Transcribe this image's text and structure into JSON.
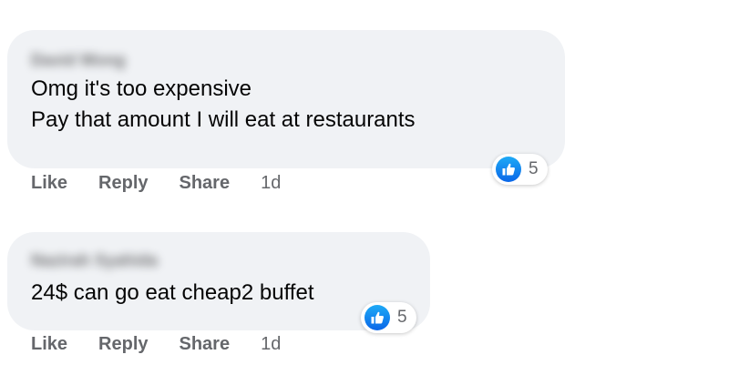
{
  "comments": [
    {
      "author": "David Wong",
      "lines": [
        "Omg it's too expensive",
        "Pay that amount I will eat at restaurants"
      ],
      "reaction_count": "5",
      "reaction_icon": "thumbs-up-icon",
      "actions": {
        "like": "Like",
        "reply": "Reply",
        "share": "Share"
      },
      "time": "1d"
    },
    {
      "author": "Nazirah Syahida",
      "lines": [
        "24$ can go eat cheap2 buffet"
      ],
      "reaction_count": "5",
      "reaction_icon": "thumbs-up-icon",
      "actions": {
        "like": "Like",
        "reply": "Reply",
        "share": "Share"
      },
      "time": "1d"
    }
  ],
  "colors": {
    "bubble": "#f0f2f5",
    "text": "#050505",
    "muted": "#65676b",
    "like_blue": "#0a66e8"
  }
}
